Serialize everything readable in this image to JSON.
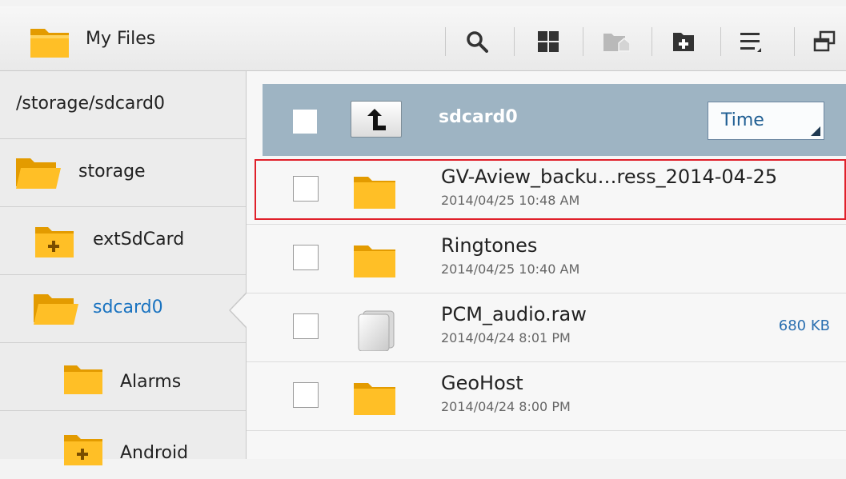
{
  "app": {
    "title": "My Files"
  },
  "toolbar": {
    "icons": [
      "search-icon",
      "grid-view-icon",
      "home-folder-icon",
      "new-folder-icon",
      "sort-list-icon",
      "window-icon"
    ]
  },
  "sidebar": {
    "current_path": "/storage/sdcard0",
    "items": [
      {
        "label": "storage",
        "icon": "folder-open-icon"
      },
      {
        "label": "extSdCard",
        "icon": "folder-plus-icon"
      },
      {
        "label": "sdcard0",
        "icon": "folder-open-icon",
        "selected": true
      },
      {
        "label": "Alarms",
        "icon": "folder-icon"
      },
      {
        "label": "Android",
        "icon": "folder-plus-icon"
      }
    ]
  },
  "header": {
    "folder_name": "sdcard0",
    "sort_value": "Time"
  },
  "files": [
    {
      "name": "GV-Aview_backu…ress_2014-04-25",
      "date": "2014/04/25 10:48 AM",
      "type": "folder",
      "size": ""
    },
    {
      "name": "Ringtones",
      "date": "2014/04/25 10:40 AM",
      "type": "folder",
      "size": ""
    },
    {
      "name": "PCM_audio.raw",
      "date": "2014/04/24 8:01 PM",
      "type": "file",
      "size": "680 KB"
    },
    {
      "name": "GeoHost",
      "date": "2014/04/24 8:00 PM",
      "type": "folder",
      "size": ""
    }
  ],
  "colors": {
    "accent": "#1a73c0",
    "path_bar": "#9eb4c3",
    "folder": "#f7a800",
    "highlight": "#e0202a"
  }
}
